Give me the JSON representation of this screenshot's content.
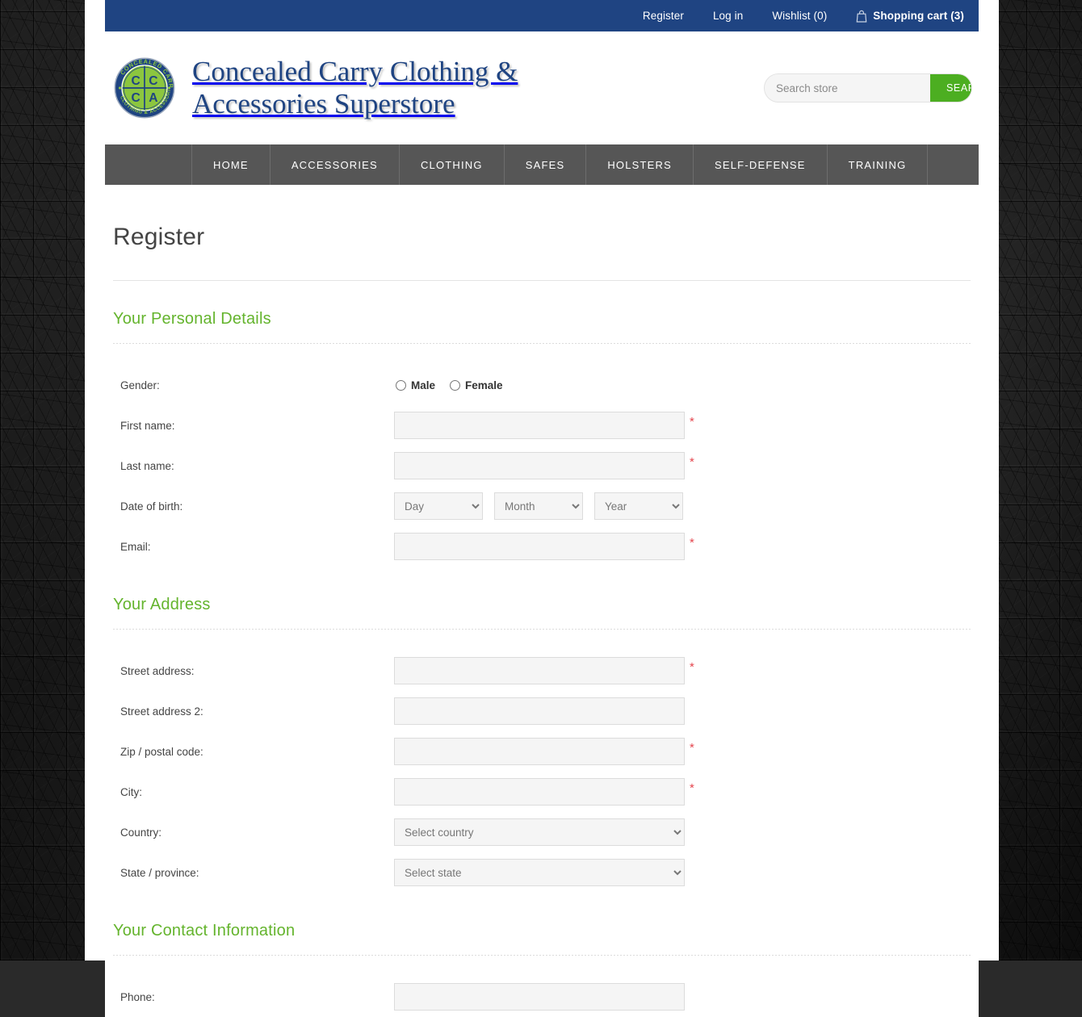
{
  "top_bar": {
    "links": [
      {
        "label": "Register",
        "name": "register"
      },
      {
        "label": "Log in",
        "name": "login"
      },
      {
        "label": "Wishlist (0)",
        "name": "wishlist"
      }
    ],
    "cart_label": "Shopping cart (3)",
    "cart_icon": "shopping-bag-icon",
    "background_color": "#1f4482"
  },
  "brand": {
    "store_name": "Concealed Carry Clothing & Accessories Superstore",
    "logo_icon": "ccca-circular-logo",
    "logo_letters": [
      "C",
      "C",
      "C",
      "A"
    ],
    "logo_ring_top_text": "CONCEALED CARRY",
    "logo_ring_bottom_text": "CLOTHING & ACCESSORIES",
    "logo_green": "#8cc63f",
    "logo_blue": "#1f4482",
    "title_color": "#1f4482"
  },
  "search": {
    "placeholder": "Search store",
    "value": "",
    "button_label": "SEARCH",
    "button_color": "#4cae21"
  },
  "nav": {
    "items": [
      {
        "label": "HOME",
        "name": "home"
      },
      {
        "label": "ACCESSORIES",
        "name": "accessories"
      },
      {
        "label": "CLOTHING",
        "name": "clothing"
      },
      {
        "label": "SAFES",
        "name": "safes"
      },
      {
        "label": "HOLSTERS",
        "name": "holsters"
      },
      {
        "label": "SELF-DEFENSE",
        "name": "self-defense"
      },
      {
        "label": "TRAINING",
        "name": "training"
      }
    ],
    "background_color": "#565656"
  },
  "page": {
    "title": "Register",
    "required_marker": "*",
    "required_color": "#e4444c",
    "section_heading_color": "#64b42d"
  },
  "sections": {
    "personal": {
      "heading": "Your Personal Details",
      "gender_label": "Gender:",
      "gender_options": [
        {
          "label": "Male",
          "value": "M",
          "checked": false
        },
        {
          "label": "Female",
          "value": "F",
          "checked": false
        }
      ],
      "first_name_label": "First name:",
      "first_name_value": "",
      "last_name_label": "Last name:",
      "last_name_value": "",
      "dob_label": "Date of birth:",
      "dob_day_placeholder": "Day",
      "dob_month_placeholder": "Month",
      "dob_year_placeholder": "Year",
      "email_label": "Email:",
      "email_value": ""
    },
    "address": {
      "heading": "Your Address",
      "street_label": "Street address:",
      "street_value": "",
      "street2_label": "Street address 2:",
      "street2_value": "",
      "zip_label": "Zip / postal code:",
      "zip_value": "",
      "city_label": "City:",
      "city_value": "",
      "country_label": "Country:",
      "country_selected": "Select country",
      "state_label": "State / province:",
      "state_selected": "Select state"
    },
    "contact": {
      "heading": "Your Contact Information",
      "phone_label": "Phone:",
      "phone_value": ""
    }
  }
}
